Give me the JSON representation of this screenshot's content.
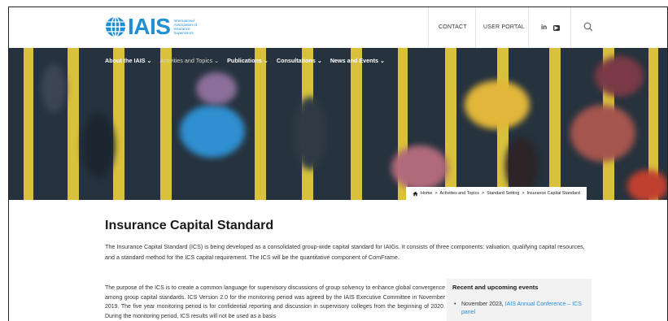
{
  "logo": {
    "text": "IAIS",
    "subtitle": "International Association of Insurance Supervisors"
  },
  "topnav": {
    "contact": "CONTACT",
    "user_portal": "USER PORTAL",
    "linkedin": "in",
    "youtube": "▶"
  },
  "mainnav": [
    {
      "label": "About the IAIS ⌄"
    },
    {
      "label": "Activities and Topics ⌄"
    },
    {
      "label": "Publications ⌄"
    },
    {
      "label": "Consultations ⌄"
    },
    {
      "label": "News and Events ⌄"
    }
  ],
  "breadcrumb": {
    "home": "Home",
    "sep": ">",
    "items": [
      "Activities and Topics",
      "Standard Setting",
      "Insurance Capital Standard"
    ]
  },
  "page": {
    "title": "Insurance Capital Standard",
    "intro": "The Insurance Capital Standard (ICS) is being developed as a consolidated group-wide capital standard for IAIGs. It consists of three components: valuation, qualifying capital resources, and a standard method for the ICS capital requirement. The ICS will be the quantitative component of ComFrame.",
    "para": "The purpose of the ICS is to create a common language for supervisory discussions of group solvency to enhance global convergence among group capital standards. ICS Version 2.0 for the monitoring period was agreed by the IAIS Executive Committee in November 2019. The five year monitoring period is for confidential reporting and discussion in supervisory colleges from the beginning of 2020. During the monitoring period, ICS results will not be used as a basis"
  },
  "sidebar": {
    "title": "Recent and upcoming events",
    "event_prefix": "November 2023, ",
    "event_link": "IAIS Annual Conference – ICS panel"
  },
  "colors": {
    "brand": "#1e8fd0",
    "link": "#2a8fd6",
    "hero_bg": "#26323d",
    "stripe": "#d9c13c"
  }
}
